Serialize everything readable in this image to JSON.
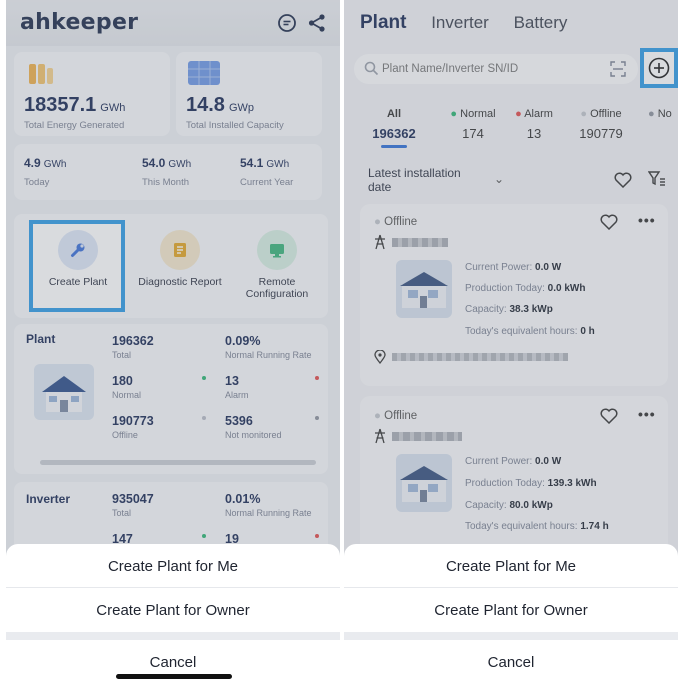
{
  "left": {
    "logo": "ahkeeper",
    "energy": {
      "value": "18357.1",
      "unit": "GWh",
      "label": "Total Energy Generated"
    },
    "capacity": {
      "value": "14.8",
      "unit": "GWp",
      "label": "Total Installed Capacity"
    },
    "periods": [
      {
        "value": "4.9",
        "unit": "GWh",
        "label": "Today"
      },
      {
        "value": "54.0",
        "unit": "GWh",
        "label": "This Month"
      },
      {
        "value": "54.1",
        "unit": "GWh",
        "label": "Current Year"
      }
    ],
    "actions": [
      {
        "label": "Create Plant",
        "icon": "wrench-icon",
        "color": "#3a6fd8"
      },
      {
        "label": "Diagnostic Report",
        "icon": "report-icon",
        "color": "#e4a623"
      },
      {
        "label": "Remote Configuration",
        "icon": "monitor-icon",
        "color": "#39b47a"
      }
    ],
    "plant": {
      "title": "Plant",
      "stats": [
        {
          "value": "196362",
          "label": "Total"
        },
        {
          "value": "0.09%",
          "label": "Normal Running Rate"
        },
        {
          "value": "180",
          "label": "Normal"
        },
        {
          "value": "13",
          "label": "Alarm"
        },
        {
          "value": "190773",
          "label": "Offline"
        },
        {
          "value": "5396",
          "label": "Not monitored"
        }
      ]
    },
    "inverter": {
      "title": "Inverter",
      "stats": [
        {
          "value": "935047",
          "label": "Total"
        },
        {
          "value": "0.01%",
          "label": "Normal Running Rate"
        },
        {
          "value": "147",
          "label": ""
        },
        {
          "value": "19",
          "label": ""
        }
      ]
    }
  },
  "right": {
    "tabs": [
      "Plant",
      "Inverter",
      "Battery"
    ],
    "search": {
      "placeholder": "Plant Name/Inverter SN/ID"
    },
    "filters": [
      {
        "label": "All",
        "value": "196362"
      },
      {
        "label": "Normal",
        "value": "174"
      },
      {
        "label": "Alarm",
        "value": "13"
      },
      {
        "label": "Offline",
        "value": "190779"
      },
      {
        "label": "No"
      }
    ],
    "sort": "Latest installation date",
    "cards": [
      {
        "status": "Offline",
        "current_power_label": "Current Power:",
        "current_power": "0.0 W",
        "production_label": "Production Today:",
        "production": "0.0 kWh",
        "capacity_label": "Capacity:",
        "capacity": "38.3 kWp",
        "hours_label": "Today's equivalent hours:",
        "hours": "0 h"
      },
      {
        "status": "Offline",
        "current_power_label": "Current Power:",
        "current_power": "0.0 W",
        "production_label": "Production Today:",
        "production": "139.3 kWh",
        "capacity_label": "Capacity:",
        "capacity": "80.0 kWp",
        "hours_label": "Today's equivalent hours:",
        "hours": "1.74 h"
      }
    ]
  },
  "sheet": {
    "option1": "Create Plant for Me",
    "option2": "Create Plant for Owner",
    "cancel": "Cancel"
  },
  "colors": {
    "highlight": "#2f9be6",
    "green": "#2bb673",
    "red": "#e24b4b",
    "gray": "#b8bcc6",
    "navy": "#1a2a55"
  }
}
